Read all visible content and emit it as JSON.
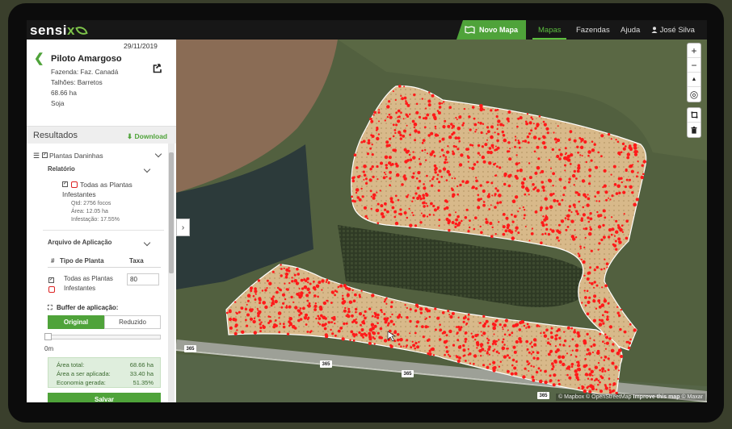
{
  "app": {
    "logo_text": "sensi",
    "logo_x": "x",
    "nav": {
      "novo_mapa": "Novo Mapa",
      "mapas": "Mapas",
      "fazendas": "Fazendas",
      "ajuda": "Ajuda",
      "user": "José Silva"
    }
  },
  "sidebar": {
    "date": "29/11/2019",
    "title": "Piloto Amargoso",
    "fazenda": "Fazenda: Faz. Canadá",
    "talhoes": "Talhões: Barretos",
    "area": "68.66 ha",
    "cultura": "Soja",
    "results_title": "Resultados",
    "download": "Download",
    "layer_name": "Plantas Daninhas",
    "relatorio": {
      "label": "Relatório",
      "item_label_1": "Todas as Plantas",
      "item_label_2": "Infestantes",
      "qtd": "Qtd: 2756 focos",
      "area": "Área: 12.05 ha",
      "infestacao": "Infestação: 17.55%"
    },
    "arquivo": {
      "label": "Arquivo de Aplicação",
      "col_num": "#",
      "col_tipo": "Tipo de Planta",
      "col_taxa": "Taxa",
      "row_label_1": "Todas as Plantas",
      "row_label_2": "Infestantes",
      "row_taxa": "80"
    },
    "buffer": {
      "label": "Buffer de aplicação:",
      "option_original": "Original",
      "option_reduzido": "Reduzido",
      "slider_value": "0m",
      "slider_fraction": 0
    },
    "summary": {
      "area_total_label": "Área total:",
      "area_total_value": "68.66 ha",
      "area_aplicada_label": "Área a ser aplicada:",
      "area_aplicada_value": "33.40 ha",
      "economia_label": "Economia gerada:",
      "economia_value": "51.35%"
    },
    "save": "Salvar"
  },
  "map": {
    "road_labels": [
      "365",
      "365",
      "365",
      "365"
    ],
    "attribution_1": "© Mapbox © OpenStreetMap",
    "attribution_2": "Improve this map",
    "attribution_3": "© Maxar",
    "controls": {
      "zoom_in": "+",
      "zoom_out": "−",
      "compass": "▲",
      "locate": "◎"
    }
  },
  "colors": {
    "accent": "#4fa33a",
    "weed": "#ff1a1a",
    "field": "#d8b98a"
  }
}
